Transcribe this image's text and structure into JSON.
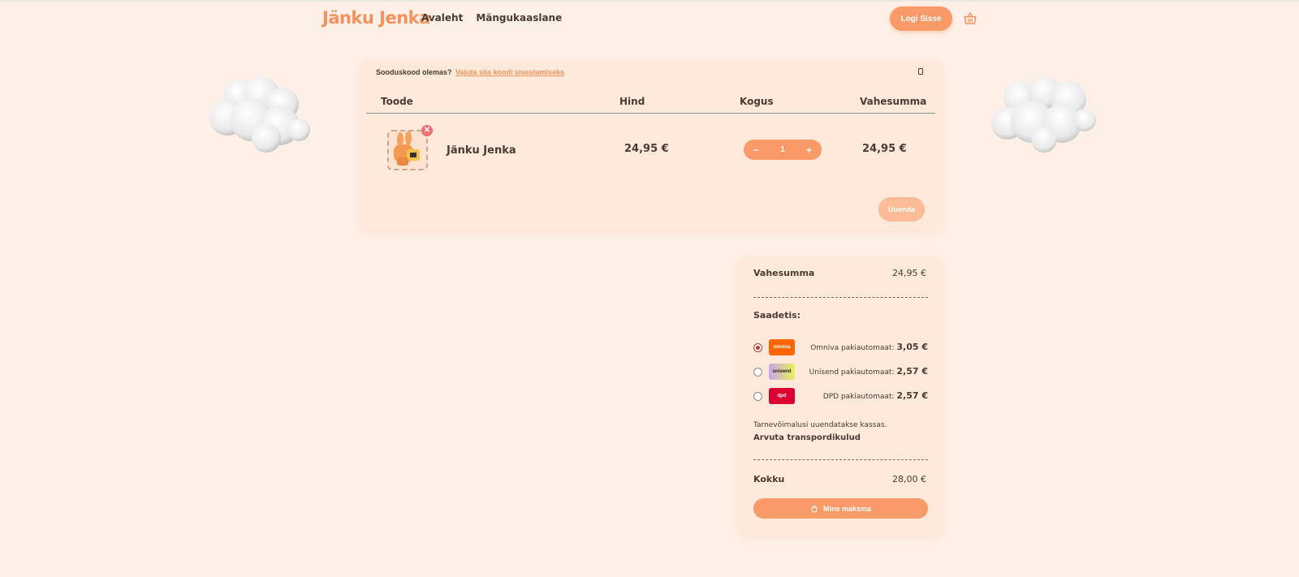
{
  "header": {
    "logo": "Jänku Jenka",
    "nav": [
      "Avaleht",
      "Mängukaaslane"
    ],
    "login_label": "Logi Sisse"
  },
  "cart": {
    "coupon_text": "Sooduskood olemas?",
    "coupon_link": "Vajuta siia koodi sisestamiseks",
    "columns": {
      "product": "Toode",
      "price": "Hind",
      "quantity": "Kogus",
      "subtotal": "Vahesumma"
    },
    "item": {
      "name": "Jänku Jenka",
      "price": "24,95 €",
      "quantity": "1",
      "subtotal": "24,95 €",
      "remove_symbol": "✕",
      "minus_symbol": "−",
      "plus_symbol": "+"
    },
    "update_label": "Uuenda"
  },
  "totals": {
    "subtotal_label": "Vahesumma",
    "subtotal_value": "24,95 €",
    "shipping_label": "Saadetis:",
    "shipping_options": [
      {
        "logo_text": "omniva",
        "label": "Omniva pakiautomaat:",
        "price": "3,05 €",
        "selected": true
      },
      {
        "logo_text": "unisend",
        "label": "Unisend pakiautomaat:",
        "price": "2,57 €",
        "selected": false
      },
      {
        "logo_text": "dpd",
        "label": "DPD pakiautomaat:",
        "price": "2,57 €",
        "selected": false
      }
    ],
    "shipping_note": "Tarnevõimalusi uuendatakse kassas.",
    "calc_label": "Arvuta transpordikulud",
    "total_label": "Kokku",
    "total_value": "28,00 €",
    "pay_label": "Mine maksma"
  },
  "colors": {
    "accent": "#f99a68",
    "brand": "#f5925d",
    "background": "#fef0e7",
    "card": "#fee9da"
  }
}
